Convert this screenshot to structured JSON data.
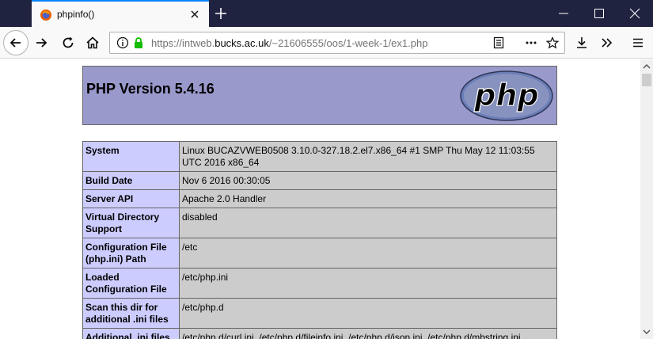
{
  "browser": {
    "tab_title": "phpinfo()",
    "url_prefix": "https://intweb.",
    "url_host": "bucks.ac.uk",
    "url_path": "/~21606555/oos/1-week-1/ex1.php"
  },
  "page": {
    "php_version": "PHP Version 5.4.16",
    "logo_text": "php",
    "rows": [
      {
        "label": "System",
        "value": "Linux BUCAZVWEB0508 3.10.0-327.18.2.el7.x86_64 #1 SMP Thu May 12 11:03:55 UTC 2016 x86_64"
      },
      {
        "label": "Build Date",
        "value": "Nov 6 2016 00:30:05"
      },
      {
        "label": "Server API",
        "value": "Apache 2.0 Handler"
      },
      {
        "label": "Virtual Directory Support",
        "value": "disabled"
      },
      {
        "label": "Configuration File (php.ini) Path",
        "value": "/etc"
      },
      {
        "label": "Loaded Configuration File",
        "value": "/etc/php.ini"
      },
      {
        "label": "Scan this dir for additional .ini files",
        "value": "/etc/php.d"
      },
      {
        "label": "Additional .ini files",
        "value": "/etc/php.d/curl.ini, /etc/php.d/fileinfo.ini, /etc/php.d/json.ini, /etc/php.d/mbstring.ini,"
      }
    ]
  },
  "colors": {
    "tabstrip": "#202340",
    "accent": "#0a84ff",
    "php_header": "#9999cc",
    "label_cell": "#ccccff",
    "value_cell": "#cccccc",
    "secure_lock": "#12bc00"
  },
  "icons": {
    "favicon": "firefox-app-icon",
    "back": "back-arrow-icon",
    "forward": "forward-arrow-icon",
    "reload": "reload-icon",
    "home": "home-icon",
    "info": "info-icon",
    "lock": "lock-icon",
    "reader": "reader-view-icon",
    "more": "page-actions-icon",
    "bookmark": "bookmark-star-icon",
    "download": "download-icon",
    "overflow": "overflow-chevrons-icon",
    "menu": "hamburger-menu-icon"
  }
}
